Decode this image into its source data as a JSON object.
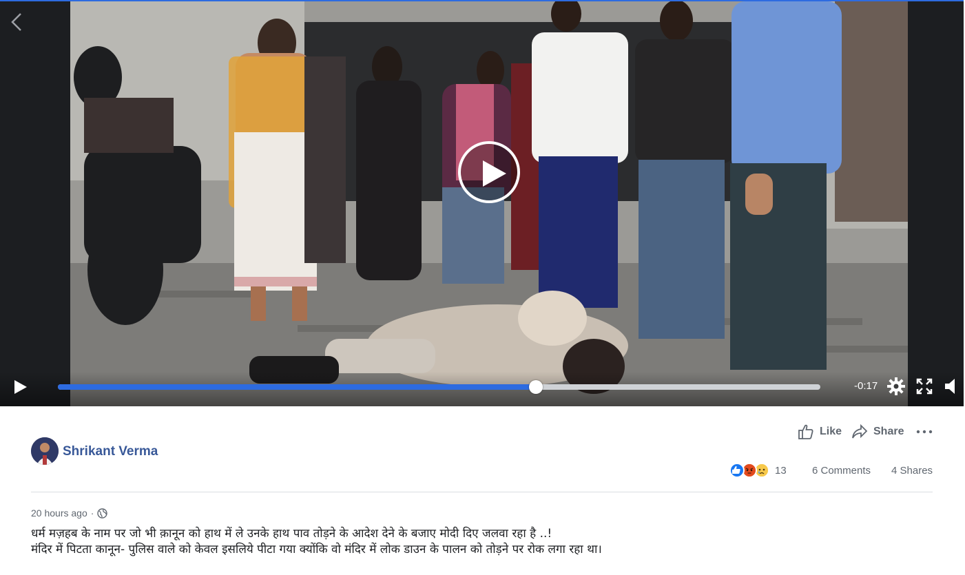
{
  "video": {
    "time_remaining": "-0:17",
    "progress_fraction": 0.627,
    "accent_color": "#2d6be0"
  },
  "post": {
    "author": "Shrikant Verma",
    "actions": {
      "like_label": "Like",
      "share_label": "Share"
    },
    "reactions": {
      "icons": [
        "like-icon",
        "angry-icon",
        "sad-icon"
      ],
      "count": "13"
    },
    "comments_label": "6 Comments",
    "shares_label": "4 Shares",
    "timestamp": "20 hours ago",
    "timestamp_separator": "·",
    "caption_line1": "धर्म मज़हब के नाम पर जो भी क़ानून को हाथ में ले उनके हाथ पाव तोड़ने के आदेश देने के बजाए मोदी दिए जलवा रहा है ..!",
    "caption_line2": "मंदिर में पिटता कानून- पुलिस वाले को केवल इसलिये पीटा गया क्योंकि वो मंदिर में लोक डाउन के पालन को तोड़ने पर रोक लगा रहा था।"
  }
}
